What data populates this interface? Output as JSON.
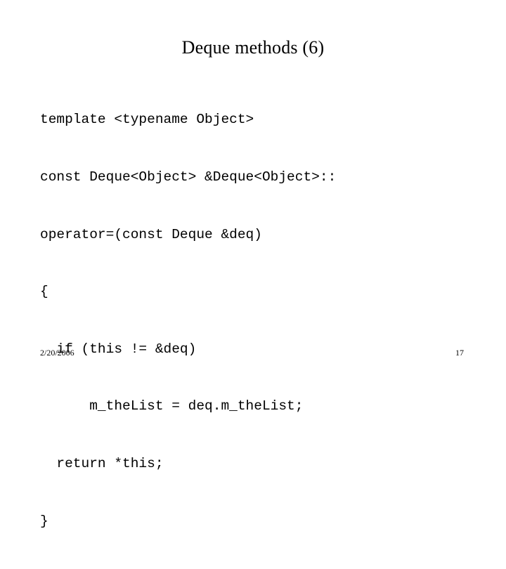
{
  "slide": {
    "title": "Deque methods (6)",
    "background_color": "#ffffff",
    "text_color": "#000000",
    "code_lines": [
      "template <typename Object>",
      "const Deque<Object> &Deque<Object>::",
      "operator=(const Deque &deq)",
      "{",
      "  if (this != &deq)",
      "      m_theList = deq.m_theList;",
      "  return *this;",
      "}"
    ],
    "footer": {
      "date": "2/20/2006",
      "page_number": "17"
    }
  }
}
